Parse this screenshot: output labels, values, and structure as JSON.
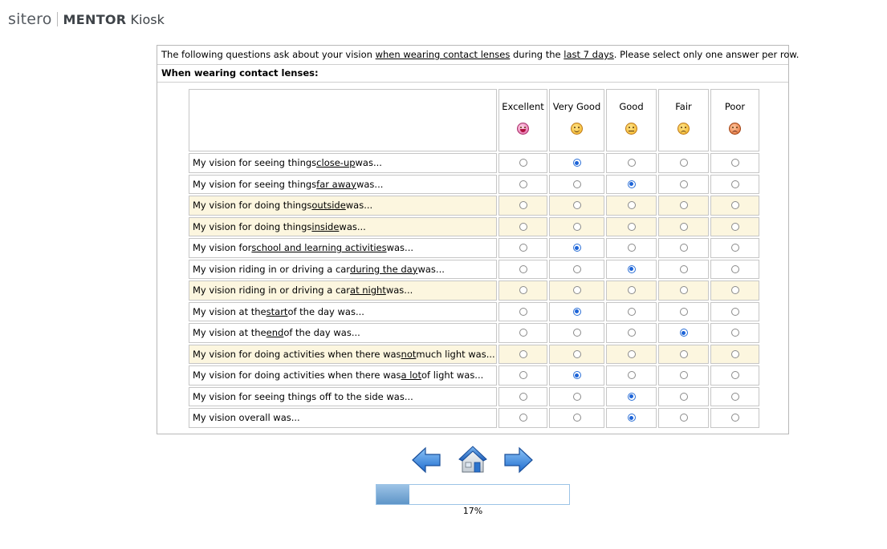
{
  "header": {
    "brand": "sitero",
    "product_bold": "MENTOR",
    "product_rest": "Kiosk"
  },
  "intro": {
    "part1": "The following questions ask about your vision ",
    "link1": "when wearing contact lenses",
    "part2": " during the ",
    "link2": "last 7 days",
    "part3": ". Please select only one answer per row."
  },
  "subheading": "When wearing contact lenses:",
  "options": [
    {
      "label": "Excellent",
      "icon": "excellent-smiley-icon"
    },
    {
      "label": "Very Good",
      "icon": "very-good-smiley-icon"
    },
    {
      "label": "Good",
      "icon": "good-smiley-icon"
    },
    {
      "label": "Fair",
      "icon": "fair-smiley-icon"
    },
    {
      "label": "Poor",
      "icon": "poor-smiley-icon"
    }
  ],
  "questions": [
    {
      "pre": "My vision for seeing things ",
      "em": "close-up",
      "post": " was...",
      "selected": 1,
      "highlighted": false
    },
    {
      "pre": "My vision for seeing things ",
      "em": "far away",
      "post": " was...",
      "selected": 2,
      "highlighted": false
    },
    {
      "pre": "My vision for doing things ",
      "em": "outside",
      "post": " was...",
      "selected": null,
      "highlighted": true
    },
    {
      "pre": "My vision for doing things ",
      "em": "inside",
      "post": " was...",
      "selected": null,
      "highlighted": true
    },
    {
      "pre": "My vision for ",
      "em": "school and learning activities",
      "post": " was...",
      "selected": 1,
      "highlighted": false
    },
    {
      "pre": "My vision riding in or driving a car ",
      "em": "during the day",
      "post": " was...",
      "selected": 2,
      "highlighted": false
    },
    {
      "pre": "My vision riding in or driving a car ",
      "em": "at night",
      "post": " was...",
      "selected": null,
      "highlighted": true
    },
    {
      "pre": "My vision at the ",
      "em": "start",
      "post": " of the day was...",
      "selected": 1,
      "highlighted": false
    },
    {
      "pre": "My vision at the ",
      "em": "end",
      "post": " of the day was...",
      "selected": 3,
      "highlighted": false
    },
    {
      "pre": "My vision for doing activities when there was ",
      "em": "not",
      "post": " much light was...",
      "selected": null,
      "highlighted": true
    },
    {
      "pre": "My vision for doing activities when there was ",
      "em": "a lot",
      "post": " of light was...",
      "selected": 1,
      "highlighted": false
    },
    {
      "pre": "My vision for seeing things off to the side was...",
      "em": "",
      "post": "",
      "selected": 2,
      "highlighted": false
    },
    {
      "pre": "My vision overall was...",
      "em": "",
      "post": "",
      "selected": 2,
      "highlighted": false
    }
  ],
  "navigation": {
    "previous_icon": "left-arrow-icon",
    "home_icon": "home-icon",
    "next_icon": "right-arrow-icon"
  },
  "progress": {
    "value": 0.17,
    "label": "17%"
  },
  "colors": {
    "highlight_row": "#fcf6df",
    "radio_selected": "#1d64d8",
    "progress_fill": "#5e95c8",
    "arrow_blue": "#2f7fd8"
  }
}
